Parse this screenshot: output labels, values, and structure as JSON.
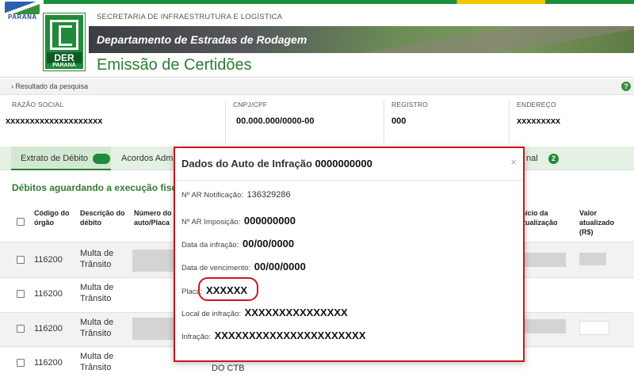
{
  "header": {
    "gov_logo_text": "PARANÁ",
    "secretaria": "SECRETARIA DE INFRAESTRUTURA E LOGÍSTICA",
    "department": "Departamento de Estradas de Rodagem",
    "page_title": "Emissão de Certidões",
    "logo_der": "DER",
    "logo_parana": "PARANÁ"
  },
  "breadcrumb": {
    "text": "› Resultado da pesquisa",
    "help_icon": "question-icon"
  },
  "info": [
    {
      "label": "RAZÃO SOCIAL",
      "value": "xxxxxxxxxxxxxxxxxxxx"
    },
    {
      "label": "CNPJ/CPF",
      "value": "00.000.000/0000-00"
    },
    {
      "label": "REGISTRO",
      "value": "000"
    },
    {
      "label": "ENDEREÇO",
      "value": "xxxxxxxxx"
    }
  ],
  "tabs": [
    {
      "label": "Extrato de Débito",
      "active": true
    },
    {
      "label": "Acordos Adm",
      "active": false
    },
    {
      "label": "nal",
      "active": false
    }
  ],
  "tab_count": "2",
  "section_title": "Débitos aguardando a execução fiscal",
  "table": {
    "headers": {
      "codigo": [
        "Código do",
        "órgão"
      ],
      "descricao": [
        "Descrição do",
        "débito"
      ],
      "numero": [
        "Número do",
        "auto/Placa"
      ],
      "inicio": [
        "Início da",
        "atualização"
      ],
      "valor": [
        "Valor",
        "atualizado",
        "(R$)"
      ]
    },
    "rows": [
      {
        "codigo": "116200",
        "descricao": [
          "Multa de",
          "Trânsito"
        ]
      },
      {
        "codigo": "116200",
        "descricao": [
          "Multa de",
          "Trânsito"
        ]
      },
      {
        "codigo": "116200",
        "descricao": [
          "Multa de",
          "Trânsito"
        ]
      },
      {
        "codigo": "116200",
        "descricao": [
          "Multa de",
          "Trânsito"
        ],
        "extra": "DO CTB"
      }
    ]
  },
  "modal": {
    "title": "Dados do Auto de Infração",
    "title_value": "0000000000",
    "close": "×",
    "fields": [
      {
        "label": "Nº AR Notificação:",
        "value": "136329286"
      },
      {
        "label": "Nº AR Imposição:",
        "value": "000000000"
      },
      {
        "label": "Data da infração:",
        "value": "00/00/0000"
      },
      {
        "label": "Data de vencimento:",
        "value": "00/00/0000"
      },
      {
        "label": "Placa:",
        "value": "XXXXXX"
      },
      {
        "label": "Local de infração:",
        "value": "XXXXXXXXXXXXXXX"
      },
      {
        "label": "Infração:",
        "value": "XXXXXXXXXXXXXXXXXXXXXX"
      }
    ]
  },
  "colors": {
    "green": "#2e7d32",
    "highlight_red": "#d0151b"
  }
}
